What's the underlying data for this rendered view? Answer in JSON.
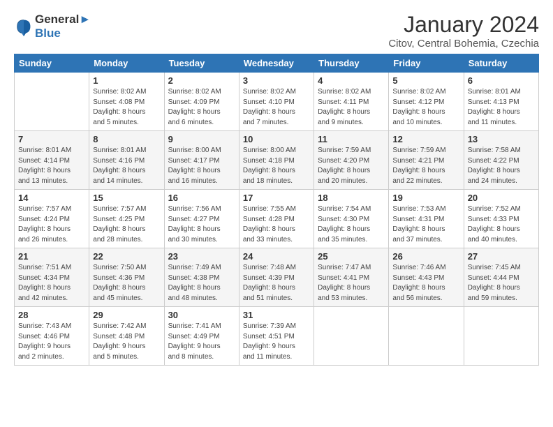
{
  "header": {
    "logo_line1": "General",
    "logo_line2": "Blue",
    "title": "January 2024",
    "subtitle": "Citov, Central Bohemia, Czechia"
  },
  "weekdays": [
    "Sunday",
    "Monday",
    "Tuesday",
    "Wednesday",
    "Thursday",
    "Friday",
    "Saturday"
  ],
  "weeks": [
    [
      {
        "day": "",
        "info": ""
      },
      {
        "day": "1",
        "info": "Sunrise: 8:02 AM\nSunset: 4:08 PM\nDaylight: 8 hours\nand 5 minutes."
      },
      {
        "day": "2",
        "info": "Sunrise: 8:02 AM\nSunset: 4:09 PM\nDaylight: 8 hours\nand 6 minutes."
      },
      {
        "day": "3",
        "info": "Sunrise: 8:02 AM\nSunset: 4:10 PM\nDaylight: 8 hours\nand 7 minutes."
      },
      {
        "day": "4",
        "info": "Sunrise: 8:02 AM\nSunset: 4:11 PM\nDaylight: 8 hours\nand 9 minutes."
      },
      {
        "day": "5",
        "info": "Sunrise: 8:02 AM\nSunset: 4:12 PM\nDaylight: 8 hours\nand 10 minutes."
      },
      {
        "day": "6",
        "info": "Sunrise: 8:01 AM\nSunset: 4:13 PM\nDaylight: 8 hours\nand 11 minutes."
      }
    ],
    [
      {
        "day": "7",
        "info": "Sunrise: 8:01 AM\nSunset: 4:14 PM\nDaylight: 8 hours\nand 13 minutes."
      },
      {
        "day": "8",
        "info": "Sunrise: 8:01 AM\nSunset: 4:16 PM\nDaylight: 8 hours\nand 14 minutes."
      },
      {
        "day": "9",
        "info": "Sunrise: 8:00 AM\nSunset: 4:17 PM\nDaylight: 8 hours\nand 16 minutes."
      },
      {
        "day": "10",
        "info": "Sunrise: 8:00 AM\nSunset: 4:18 PM\nDaylight: 8 hours\nand 18 minutes."
      },
      {
        "day": "11",
        "info": "Sunrise: 7:59 AM\nSunset: 4:20 PM\nDaylight: 8 hours\nand 20 minutes."
      },
      {
        "day": "12",
        "info": "Sunrise: 7:59 AM\nSunset: 4:21 PM\nDaylight: 8 hours\nand 22 minutes."
      },
      {
        "day": "13",
        "info": "Sunrise: 7:58 AM\nSunset: 4:22 PM\nDaylight: 8 hours\nand 24 minutes."
      }
    ],
    [
      {
        "day": "14",
        "info": "Sunrise: 7:57 AM\nSunset: 4:24 PM\nDaylight: 8 hours\nand 26 minutes."
      },
      {
        "day": "15",
        "info": "Sunrise: 7:57 AM\nSunset: 4:25 PM\nDaylight: 8 hours\nand 28 minutes."
      },
      {
        "day": "16",
        "info": "Sunrise: 7:56 AM\nSunset: 4:27 PM\nDaylight: 8 hours\nand 30 minutes."
      },
      {
        "day": "17",
        "info": "Sunrise: 7:55 AM\nSunset: 4:28 PM\nDaylight: 8 hours\nand 33 minutes."
      },
      {
        "day": "18",
        "info": "Sunrise: 7:54 AM\nSunset: 4:30 PM\nDaylight: 8 hours\nand 35 minutes."
      },
      {
        "day": "19",
        "info": "Sunrise: 7:53 AM\nSunset: 4:31 PM\nDaylight: 8 hours\nand 37 minutes."
      },
      {
        "day": "20",
        "info": "Sunrise: 7:52 AM\nSunset: 4:33 PM\nDaylight: 8 hours\nand 40 minutes."
      }
    ],
    [
      {
        "day": "21",
        "info": "Sunrise: 7:51 AM\nSunset: 4:34 PM\nDaylight: 8 hours\nand 42 minutes."
      },
      {
        "day": "22",
        "info": "Sunrise: 7:50 AM\nSunset: 4:36 PM\nDaylight: 8 hours\nand 45 minutes."
      },
      {
        "day": "23",
        "info": "Sunrise: 7:49 AM\nSunset: 4:38 PM\nDaylight: 8 hours\nand 48 minutes."
      },
      {
        "day": "24",
        "info": "Sunrise: 7:48 AM\nSunset: 4:39 PM\nDaylight: 8 hours\nand 51 minutes."
      },
      {
        "day": "25",
        "info": "Sunrise: 7:47 AM\nSunset: 4:41 PM\nDaylight: 8 hours\nand 53 minutes."
      },
      {
        "day": "26",
        "info": "Sunrise: 7:46 AM\nSunset: 4:43 PM\nDaylight: 8 hours\nand 56 minutes."
      },
      {
        "day": "27",
        "info": "Sunrise: 7:45 AM\nSunset: 4:44 PM\nDaylight: 8 hours\nand 59 minutes."
      }
    ],
    [
      {
        "day": "28",
        "info": "Sunrise: 7:43 AM\nSunset: 4:46 PM\nDaylight: 9 hours\nand 2 minutes."
      },
      {
        "day": "29",
        "info": "Sunrise: 7:42 AM\nSunset: 4:48 PM\nDaylight: 9 hours\nand 5 minutes."
      },
      {
        "day": "30",
        "info": "Sunrise: 7:41 AM\nSunset: 4:49 PM\nDaylight: 9 hours\nand 8 minutes."
      },
      {
        "day": "31",
        "info": "Sunrise: 7:39 AM\nSunset: 4:51 PM\nDaylight: 9 hours\nand 11 minutes."
      },
      {
        "day": "",
        "info": ""
      },
      {
        "day": "",
        "info": ""
      },
      {
        "day": "",
        "info": ""
      }
    ]
  ]
}
